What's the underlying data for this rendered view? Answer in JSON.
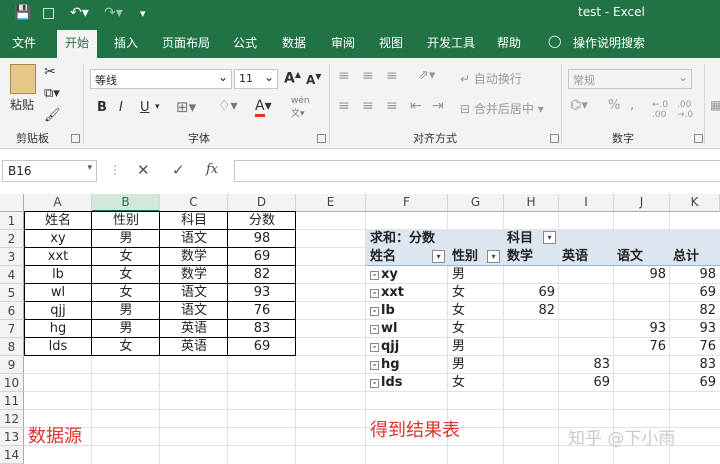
{
  "window": {
    "title": "test  -  Excel"
  },
  "tabs": [
    "文件",
    "开始",
    "插入",
    "页面布局",
    "公式",
    "数据",
    "审阅",
    "视图",
    "开发工具",
    "帮助",
    "操作说明搜索"
  ],
  "ribbon": {
    "clipboard": {
      "paste": "粘贴",
      "label": "剪贴板"
    },
    "font": {
      "name": "等线",
      "size": "11",
      "grow": "A",
      "shrink": "A",
      "bold": "B",
      "italic": "I",
      "underline": "U",
      "color_a": "A",
      "wen": "wén",
      "label": "字体"
    },
    "alignment": {
      "wrap": "自动换行",
      "merge": "合并后居中",
      "label": "对齐方式"
    },
    "number": {
      "format": "常规",
      "percent": "%",
      "comma": ",",
      "label": "数字"
    }
  },
  "formula_bar": {
    "name_box": "B16",
    "fx": "fx",
    "value": ""
  },
  "columns": [
    "A",
    "B",
    "C",
    "D",
    "E",
    "F",
    "G",
    "H",
    "I",
    "J",
    "K"
  ],
  "rows": [
    "1",
    "2",
    "3",
    "4",
    "5",
    "6",
    "7",
    "8",
    "9",
    "10",
    "11",
    "12",
    "13",
    "14"
  ],
  "source_table": {
    "headers": [
      "姓名",
      "性别",
      "科目",
      "分数"
    ],
    "rows": [
      [
        "xy",
        "男",
        "语文",
        "98"
      ],
      [
        "xxt",
        "女",
        "数学",
        "69"
      ],
      [
        "lb",
        "女",
        "数学",
        "82"
      ],
      [
        "wl",
        "女",
        "语文",
        "93"
      ],
      [
        "qjj",
        "男",
        "语文",
        "76"
      ],
      [
        "hg",
        "男",
        "英语",
        "83"
      ],
      [
        "lds",
        "女",
        "英语",
        "69"
      ]
    ]
  },
  "pivot": {
    "value_label": "求和：分数",
    "column_field": "科目",
    "row_field_1": "姓名",
    "row_field_2": "性别",
    "col_headers": [
      "数学",
      "英语",
      "语文",
      "总计"
    ],
    "rows": [
      {
        "name": "xy",
        "sex": "男",
        "math": "",
        "english": "",
        "chinese": "98",
        "total": "98"
      },
      {
        "name": "xxt",
        "sex": "女",
        "math": "69",
        "english": "",
        "chinese": "",
        "total": "69"
      },
      {
        "name": "lb",
        "sex": "女",
        "math": "82",
        "english": "",
        "chinese": "",
        "total": "82"
      },
      {
        "name": "wl",
        "sex": "女",
        "math": "",
        "english": "",
        "chinese": "93",
        "total": "93"
      },
      {
        "name": "qjj",
        "sex": "男",
        "math": "",
        "english": "",
        "chinese": "76",
        "total": "76"
      },
      {
        "name": "hg",
        "sex": "男",
        "math": "",
        "english": "83",
        "chinese": "",
        "total": "83"
      },
      {
        "name": "lds",
        "sex": "女",
        "math": "",
        "english": "69",
        "chinese": "",
        "total": "69"
      }
    ]
  },
  "annotations": {
    "source": "数据源",
    "result": "得到结果表",
    "watermark": "知乎 @下小雨"
  }
}
